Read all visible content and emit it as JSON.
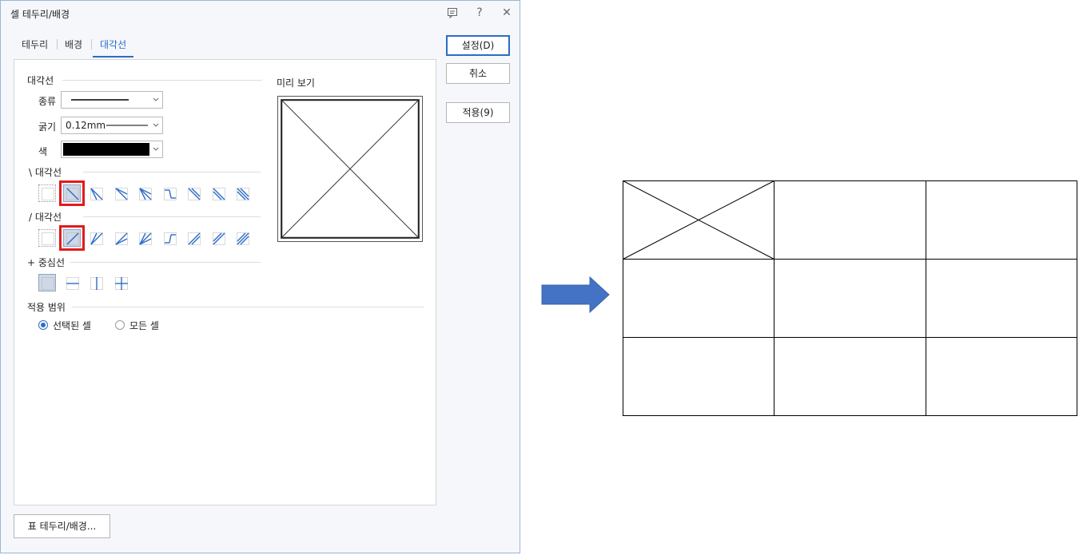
{
  "dialog": {
    "title": "셀 테두리/배경",
    "title_buttons": [
      "comment-icon",
      "help-icon",
      "close-icon"
    ],
    "help_label": "?",
    "close_label": "✕"
  },
  "tabs": [
    {
      "label": "테두리",
      "active": false
    },
    {
      "label": "배경",
      "active": false
    },
    {
      "label": "대각선",
      "active": true
    }
  ],
  "diagonal": {
    "section_title": "대각선",
    "type_label": "종류",
    "thickness_label": "굵기",
    "thickness_value": "0.12mm",
    "color_label": "색",
    "color_value": "#000000",
    "backslash_title": "\\ 대각선",
    "slash_title": "/ 대각선",
    "center_title": "+ 중심선",
    "backslash_selected_index": 1,
    "slash_selected_index": 1,
    "center_selected_index": 0
  },
  "preview": {
    "title": "미리 보기"
  },
  "scope": {
    "title": "적용 범위",
    "options": [
      {
        "label": "선택된 셀",
        "selected": true
      },
      {
        "label": "모든 셀",
        "selected": false
      }
    ]
  },
  "buttons": {
    "ok": "설정(D)",
    "cancel": "취소",
    "apply": "적용(9)",
    "table_border": "표 테두리/배경..."
  },
  "colors": {
    "accent": "#2c6cc7",
    "highlight": "#e21b1b",
    "arrow": "#4472c4"
  }
}
